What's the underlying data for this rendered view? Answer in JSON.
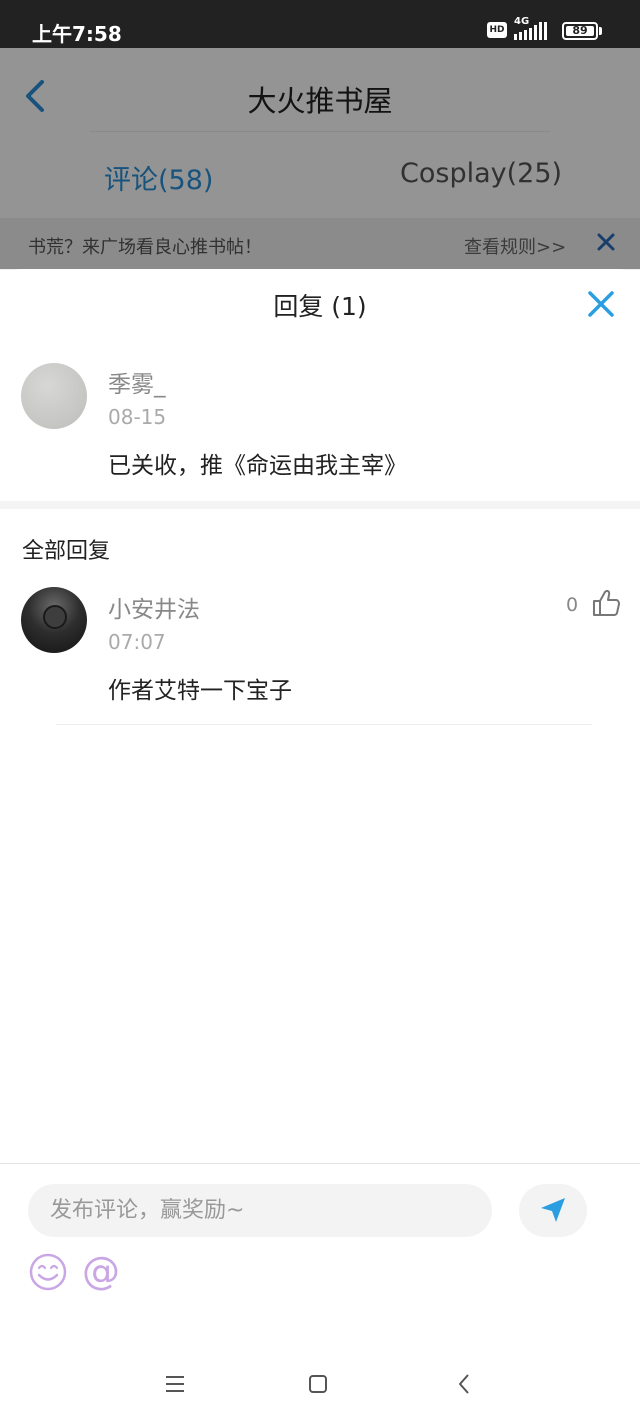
{
  "status_bar": {
    "time": "上午7:58",
    "hd": "HD",
    "network": "4G",
    "battery": "89"
  },
  "header": {
    "title": "大火推书屋"
  },
  "tabs": [
    {
      "label": "评论(58)"
    },
    {
      "label": "Cosplay(25)"
    }
  ],
  "notice": {
    "text": "书荒？来广场看良心推书帖！",
    "link": "查看规则>>"
  },
  "sheet": {
    "title": "回复 (1)",
    "original_comment": {
      "username": "季雾_",
      "date": "08-15",
      "content": "已关收，推《命运由我主宰》"
    },
    "section_title": "全部回复",
    "replies": [
      {
        "username": "小安井法",
        "time": "07:07",
        "content": "作者艾特一下宝子",
        "likes": "0"
      }
    ]
  },
  "input": {
    "placeholder": "发布评论，赢奖励~",
    "mention": "@"
  },
  "colors": {
    "accent": "#2a8fd8",
    "emoji": "#c9a6e4"
  }
}
